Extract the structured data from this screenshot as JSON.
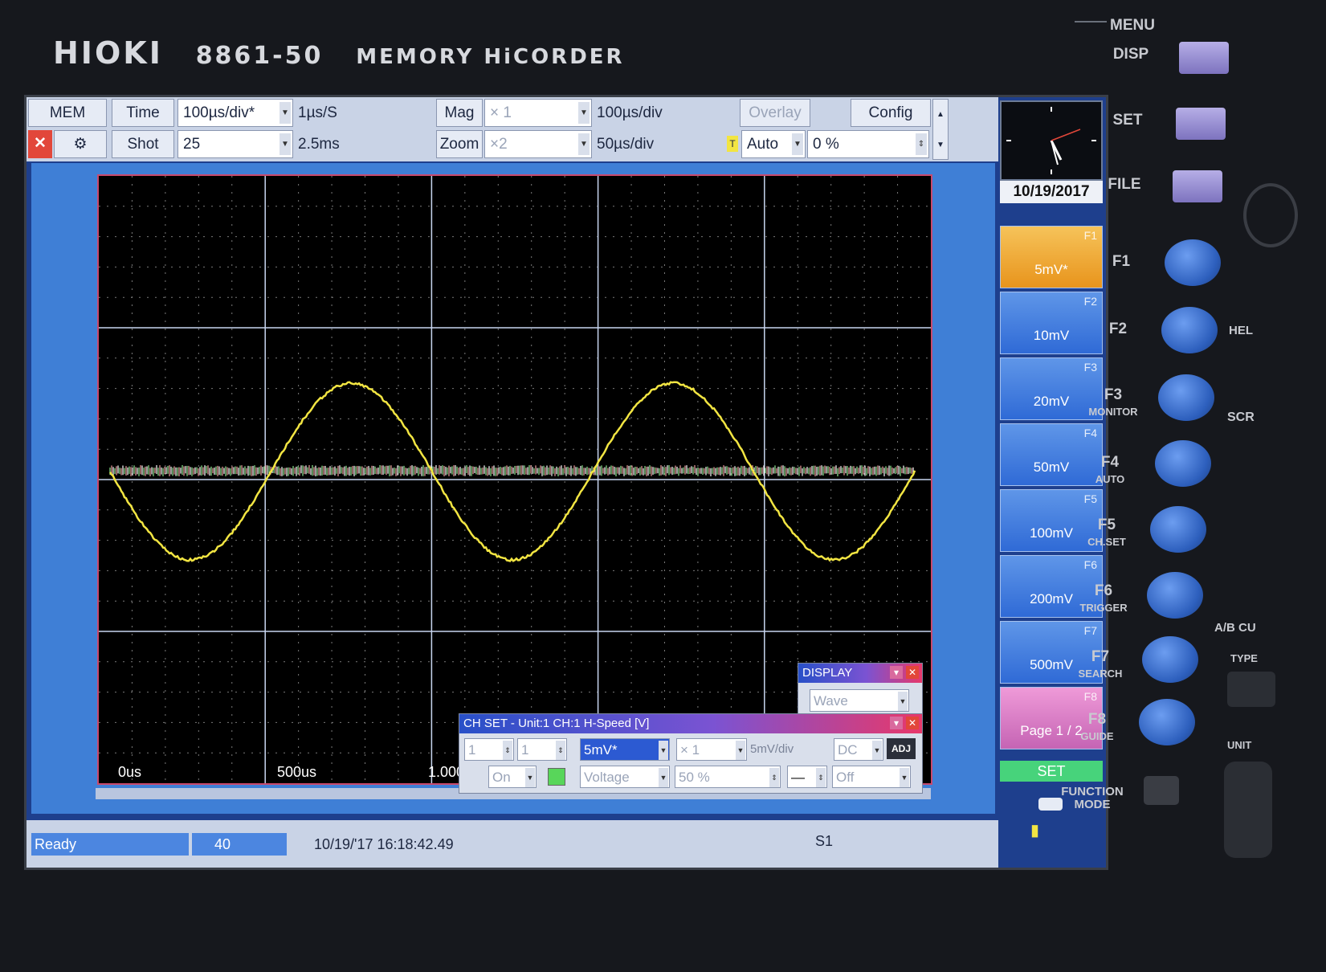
{
  "device": {
    "brand": "HIOKI",
    "model": "8861-50",
    "product": "MEMORY HiCORDER"
  },
  "toolbar": {
    "mem_label": "MEM",
    "time_label": "Time",
    "time_div": "100µs/div*",
    "sample_rate": "1µs/S",
    "mag_label": "Mag",
    "mag_value": "× 1",
    "mag_div": "100µs/div",
    "overlay_label": "Overlay",
    "config_label": "Config",
    "shot_label": "Shot",
    "shot_value": "25",
    "shot_length": "2.5ms",
    "zoom_label": "Zoom",
    "zoom_value": "×2",
    "zoom_div": "50µs/div",
    "trigger_mode": "Auto",
    "trigger_percent": "0 %"
  },
  "clock": {
    "date": "10/19/2017"
  },
  "function_keys": [
    {
      "key": "F1",
      "label": "5mV*",
      "active": true
    },
    {
      "key": "F2",
      "label": "10mV"
    },
    {
      "key": "F3",
      "label": "20mV"
    },
    {
      "key": "F4",
      "label": "50mV"
    },
    {
      "key": "F5",
      "label": "100mV"
    },
    {
      "key": "F6",
      "label": "200mV"
    },
    {
      "key": "F7",
      "label": "500mV"
    },
    {
      "key": "F8",
      "label": "Page 1 / 2"
    }
  ],
  "set_button": "SET",
  "plot": {
    "x_labels": [
      "0us",
      "500us",
      "1.000"
    ],
    "trace_color": "#f2e542",
    "noise_colors": [
      "#ffffff",
      "#8fe88f",
      "#f0a0a0"
    ]
  },
  "display_dialog": {
    "title": "DISPLAY",
    "mode": "Wave"
  },
  "chset_dialog": {
    "title": "CH SET - Unit:1 CH:1 H-Speed [V]",
    "unit": "1",
    "channel": "1",
    "range": "5mV*",
    "mag": "× 1",
    "range_div": "5mV/div",
    "coupling": "DC",
    "adj": "ADJ",
    "display": "On",
    "mode": "Voltage",
    "position": "50 %",
    "filter": "Off"
  },
  "statusbar": {
    "status": "Ready",
    "count": "40",
    "timestamp": "10/19/'17 16:18:42.49",
    "sheet": "S1"
  },
  "hardware": {
    "menu": "MENU",
    "disp": "DISP",
    "set": "SET",
    "file": "FILE",
    "keys": [
      {
        "name": "F1",
        "sub": ""
      },
      {
        "name": "F2",
        "sub": ""
      },
      {
        "name": "F3",
        "sub": "MONITOR"
      },
      {
        "name": "F4",
        "sub": "AUTO"
      },
      {
        "name": "F5",
        "sub": "CH.SET"
      },
      {
        "name": "F6",
        "sub": "TRIGGER"
      },
      {
        "name": "F7",
        "sub": "SEARCH"
      },
      {
        "name": "F8",
        "sub": "GUIDE"
      }
    ],
    "function_mode": "FUNCTION MODE",
    "side_labels": [
      "HEL",
      "SCR",
      "A/B CU",
      "TYPE",
      "UNIT"
    ]
  }
}
